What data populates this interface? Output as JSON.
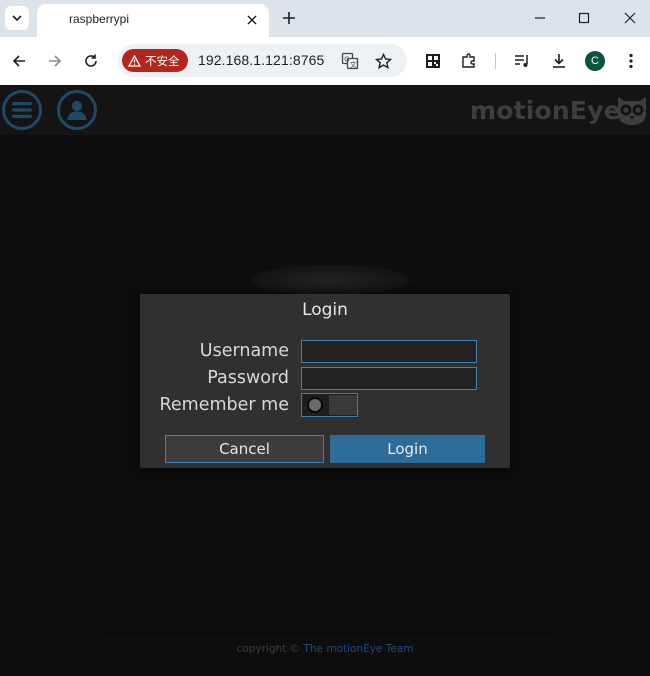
{
  "browser": {
    "tab_title": "raspberrypi",
    "security_label": "不安全",
    "url": "192.168.1.121:8765",
    "profile_initial": "C",
    "accent_color": "#b3261e"
  },
  "app": {
    "logo_text": "motionEye",
    "header_buttons": [
      "menu-icon",
      "user-icon"
    ]
  },
  "login_dialog": {
    "title": "Login",
    "username_label": "Username",
    "username_value": "",
    "password_label": "Password",
    "password_value": "",
    "remember_label": "Remember me",
    "remember_checked": false,
    "cancel_label": "Cancel",
    "login_label": "Login"
  },
  "footer": {
    "prefix": "copyright ©",
    "team_link": "The motionEye Team"
  }
}
